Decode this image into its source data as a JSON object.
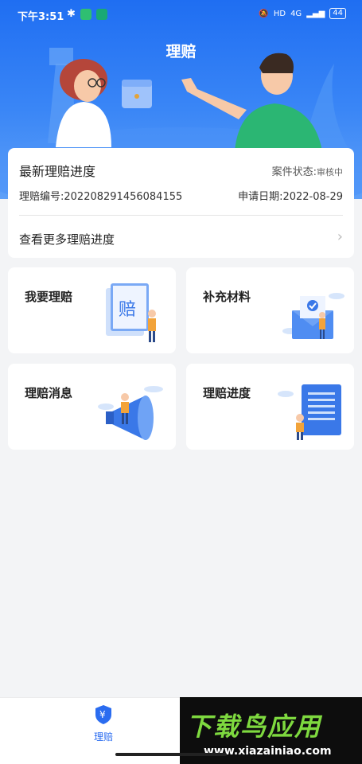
{
  "status_bar": {
    "time": "下午3:51",
    "network": "4G",
    "hd": "HD",
    "battery": "44"
  },
  "header": {
    "title": "理赔"
  },
  "progress_card": {
    "title": "最新理赔进度",
    "status_label": "案件状态:",
    "status_value": "审核中",
    "claim_no": "理赔编号:202208291456084155",
    "apply_date": "申请日期:2022-08-29",
    "more_link": "查看更多理赔进度"
  },
  "tiles": [
    {
      "label": "我要理赔",
      "illustration_text": "赔"
    },
    {
      "label": "补充材料"
    },
    {
      "label": "理赔消息"
    },
    {
      "label": "理赔进度"
    }
  ],
  "bottom_nav": {
    "claim_tab": "理赔",
    "claim_icon_text": "¥"
  },
  "watermark": {
    "brand": "下载鸟应用",
    "url": "www.xiazainiao.com"
  },
  "colors": {
    "primary": "#2a6cf0",
    "header_top": "#1f6ef2",
    "watermark_green": "#7ed93f"
  }
}
